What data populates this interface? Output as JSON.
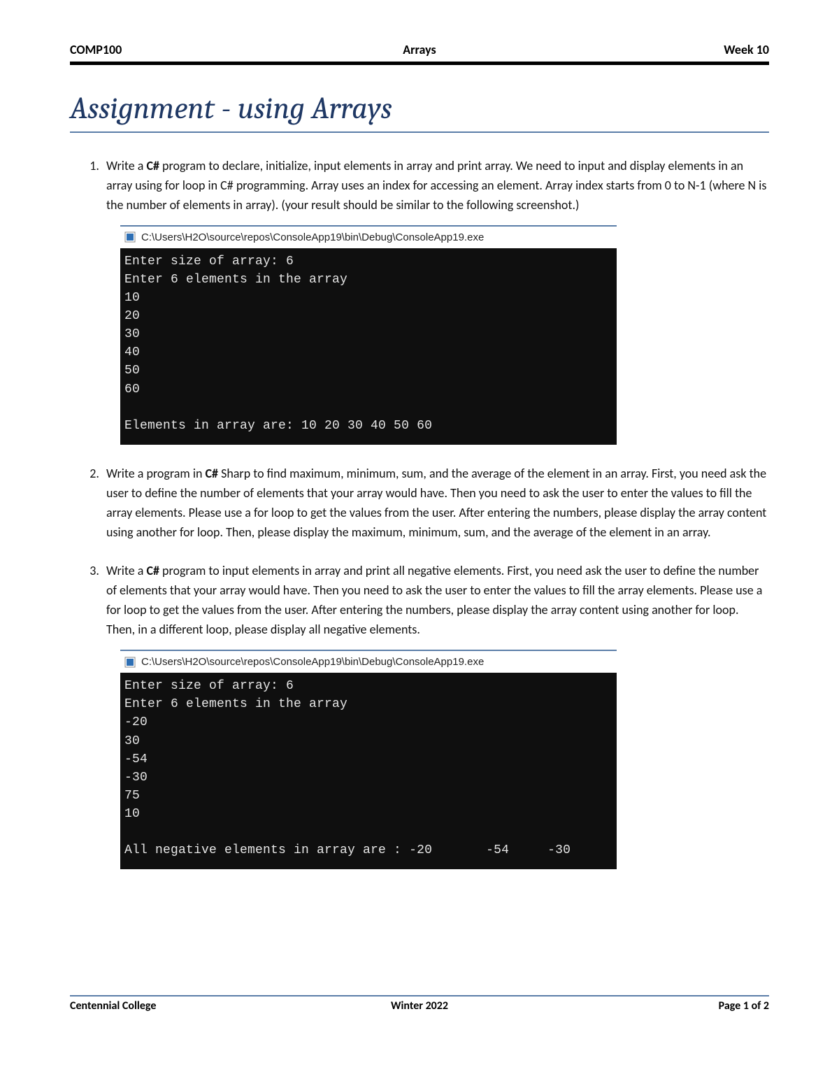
{
  "header": {
    "left": "COMP100",
    "center": "Arrays",
    "right": "Week 10"
  },
  "title": "Assignment - using Arrays",
  "items": [
    {
      "pre": "Write a ",
      "bold1": "C#",
      "mid": " program to declare, initialize, input elements in array and print array. We need to input and display elements in an array using for loop in C# programming. Array uses an index for accessing an element. Array index starts from 0 to N-1 (where N is the number of elements in array). (your result should be similar to the following screenshot.)",
      "console": {
        "path": "C:\\Users\\H2O\\source\\repos\\ConsoleApp19\\bin\\Debug\\ConsoleApp19.exe",
        "lines": "Enter size of array: 6\nEnter 6 elements in the array\n10\n20\n30\n40\n50\n60\n\nElements in array are: 10 20 30 40 50 60"
      }
    },
    {
      "pre": "Write a program in ",
      "bold1": "C#",
      "mid": " Sharp to find maximum, minimum, sum, and the average of the element in an array. First, you need ask the user to define the number of elements that your array would have. Then you need to ask the user to enter the values to fill the array elements. Please use a for loop to get the values from the user. After entering the numbers, please display the array content using another for loop. Then, please display the maximum, minimum, sum, and the average of the element in an array."
    },
    {
      "pre": "Write a ",
      "bold1": "C#",
      "mid": " program to input elements in array and print all negative elements. First, you need ask the user to define the number of elements that your array would have. Then you need to ask the user to enter the values to fill the array elements. Please use a for loop to get the values from the user. After entering the numbers, please display the array content using another for loop. Then, in a different loop, please display all negative elements.",
      "console": {
        "path": "C:\\Users\\H2O\\source\\repos\\ConsoleApp19\\bin\\Debug\\ConsoleApp19.exe",
        "lines": "Enter size of array: 6\nEnter 6 elements in the array\n-20\n30\n-54\n-30\n75\n10\n\nAll negative elements in array are : -20       -54     -30"
      }
    }
  ],
  "footer": {
    "left": "Centennial College",
    "center": "Winter 2022",
    "right_prefix": "Page ",
    "page_current": "1",
    "page_of": " of ",
    "page_total": "2"
  }
}
